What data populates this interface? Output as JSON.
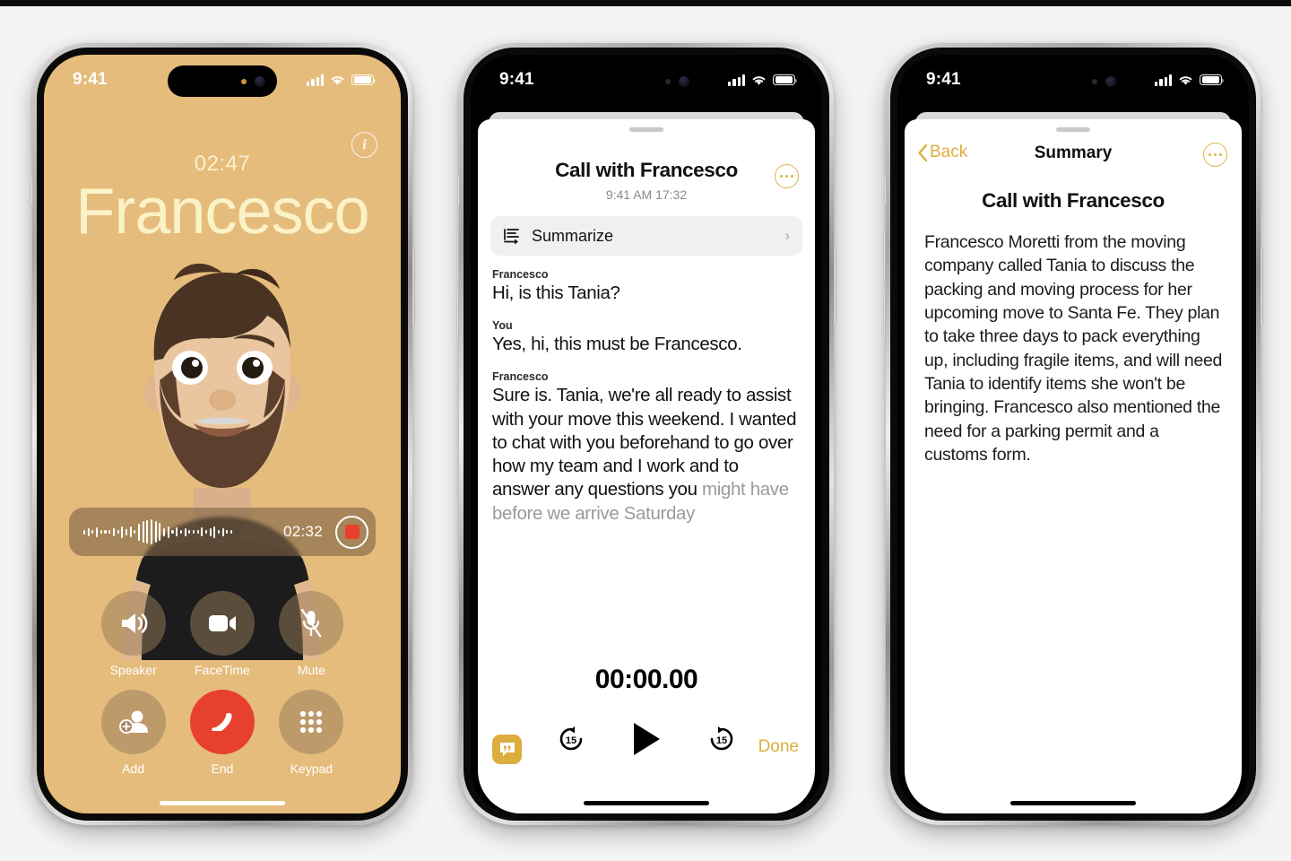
{
  "background_color": "#f5f4f5",
  "accent_gold": "#dcae3e",
  "call_bg": "#e5bc7c",
  "end_red": "#e8402e",
  "phone1": {
    "status_bar": {
      "time": "9:41",
      "signal_icon": "cellular-bars-icon",
      "wifi_icon": "wifi-icon",
      "battery_icon": "battery-icon"
    },
    "info_button": {
      "icon": "info-icon",
      "label": "i"
    },
    "call_timer": "02:47",
    "caller_name": "Francesco",
    "avatar": "memoji-avatar",
    "recording": {
      "waveform_icon": "audio-waveform-icon",
      "time": "02:32",
      "stop_button_icon": "stop-record-icon"
    },
    "controls": [
      {
        "label": "Speaker",
        "icon": "speaker-icon",
        "name": "speaker-button"
      },
      {
        "label": "FaceTime",
        "icon": "video-icon",
        "name": "facetime-button"
      },
      {
        "label": "Mute",
        "icon": "mic-off-icon",
        "name": "mute-button"
      },
      {
        "label": "Add",
        "icon": "add-person-icon",
        "name": "add-call-button"
      },
      {
        "label": "End",
        "icon": "end-call-icon",
        "name": "end-call-button"
      },
      {
        "label": "Keypad",
        "icon": "keypad-icon",
        "name": "keypad-button"
      }
    ]
  },
  "phone2": {
    "status_bar": {
      "time": "9:41"
    },
    "title": "Call with Francesco",
    "subtitle": "9:41 AM  17:32",
    "more_button_icon": "ellipsis-circle-icon",
    "summarize": {
      "label": "Summarize",
      "icon": "summarize-icon",
      "chevron": "›"
    },
    "transcript": [
      {
        "speaker": "Francesco",
        "text": "Hi, is this Tania?",
        "faded": false
      },
      {
        "speaker": "You",
        "text": "Yes, hi, this must be Francesco.",
        "faded": false
      },
      {
        "speaker": "Francesco",
        "text": "Sure is. Tania, we're all ready to assist with your move this weekend. I wanted to chat with you beforehand to go over how my team and I work and to answer any questions you ",
        "tail": "might have before we arrive Saturday",
        "faded": true
      }
    ],
    "player": {
      "time": "00:00.00",
      "skip_back_label": "15",
      "skip_back_icon": "skip-back-15-icon",
      "play_icon": "play-icon",
      "skip_forward_label": "15",
      "skip_forward_icon": "skip-forward-15-icon"
    },
    "quote_button_icon": "quote-bubble-icon",
    "done_label": "Done"
  },
  "phone3": {
    "status_bar": {
      "time": "9:41"
    },
    "back_label": "Back",
    "back_icon": "chevron-left-icon",
    "nav_title": "Summary",
    "more_button_icon": "ellipsis-circle-icon",
    "heading": "Call with Francesco",
    "body": "Francesco Moretti from the moving company called Tania to discuss the packing and moving process for her upcoming move to Santa Fe. They plan to take three days to pack everything up, including fragile items, and will need Tania to identify items she won't be bringing. Francesco also mentioned the need for a parking permit and a customs form."
  }
}
